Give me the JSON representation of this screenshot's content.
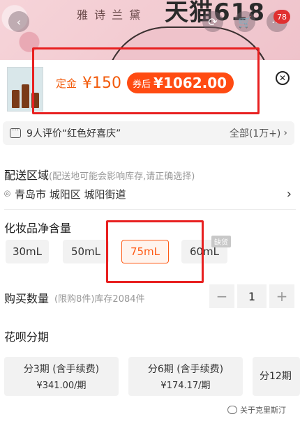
{
  "banner": {
    "brand": "雅 诗 兰 黛",
    "big_text": "天猫618",
    "cart_count": "78"
  },
  "product": {
    "deposit_label": "定金",
    "deposit_value": "¥150",
    "after_label": "券后",
    "after_value": "¥1062.00"
  },
  "reviews": {
    "text": "9人评价“红色好喜庆”",
    "all_label": "全部(1万+)"
  },
  "delivery": {
    "title": "配送区域",
    "hint": "(配送地可能会影响库存,请正确选择)",
    "address": "青岛市 城阳区 城阳街道"
  },
  "volume": {
    "title": "化妆品净含量",
    "options": [
      "30mL",
      "50mL",
      "75mL",
      "60mL"
    ],
    "selected": "75mL",
    "out_of_stock_tag": "缺货"
  },
  "quantity": {
    "title": "购买数量",
    "hint": "(限购8件)库存2084件",
    "value": "1",
    "minus": "−",
    "plus": "+"
  },
  "installments": {
    "title": "花呗分期",
    "cards": [
      {
        "label": "分3期 (含手续费)",
        "sub": "¥341.00/期"
      },
      {
        "label": "分6期 (含手续费)",
        "sub": "¥174.17/期"
      },
      {
        "label": "分12期",
        "sub": ""
      }
    ]
  },
  "watermark": "关于克里斯汀"
}
